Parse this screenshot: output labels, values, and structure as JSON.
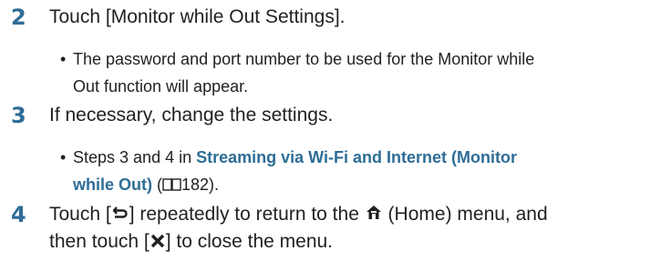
{
  "steps": [
    {
      "number": "2",
      "text": "Touch [Monitor while Out Settings].",
      "bullet_line1": "The password and port number to be used for the Monitor while",
      "bullet_line2": "Out function will appear."
    },
    {
      "number": "3",
      "text": "If necessary, change the settings.",
      "bullet_prefix": "Steps 3 and 4 in ",
      "link_line1": "Streaming via Wi-Fi and Internet (Monitor",
      "link_line2": "while Out)",
      "ref_open": " (",
      "ref_page": "182",
      "ref_close": ")."
    },
    {
      "number": "4",
      "text_part1": "Touch [",
      "text_part2": "] repeatedly to return to the ",
      "text_part3": " (Home) menu, and",
      "line2_part1": "then touch [",
      "line2_part2": "] to close the menu."
    }
  ],
  "icons": {
    "return": "return-arrow-icon",
    "home": "home-icon",
    "close": "close-x-icon",
    "reference": "book-reference-icon"
  },
  "colors": {
    "accent": "#2e6d96",
    "text": "#231f20"
  }
}
